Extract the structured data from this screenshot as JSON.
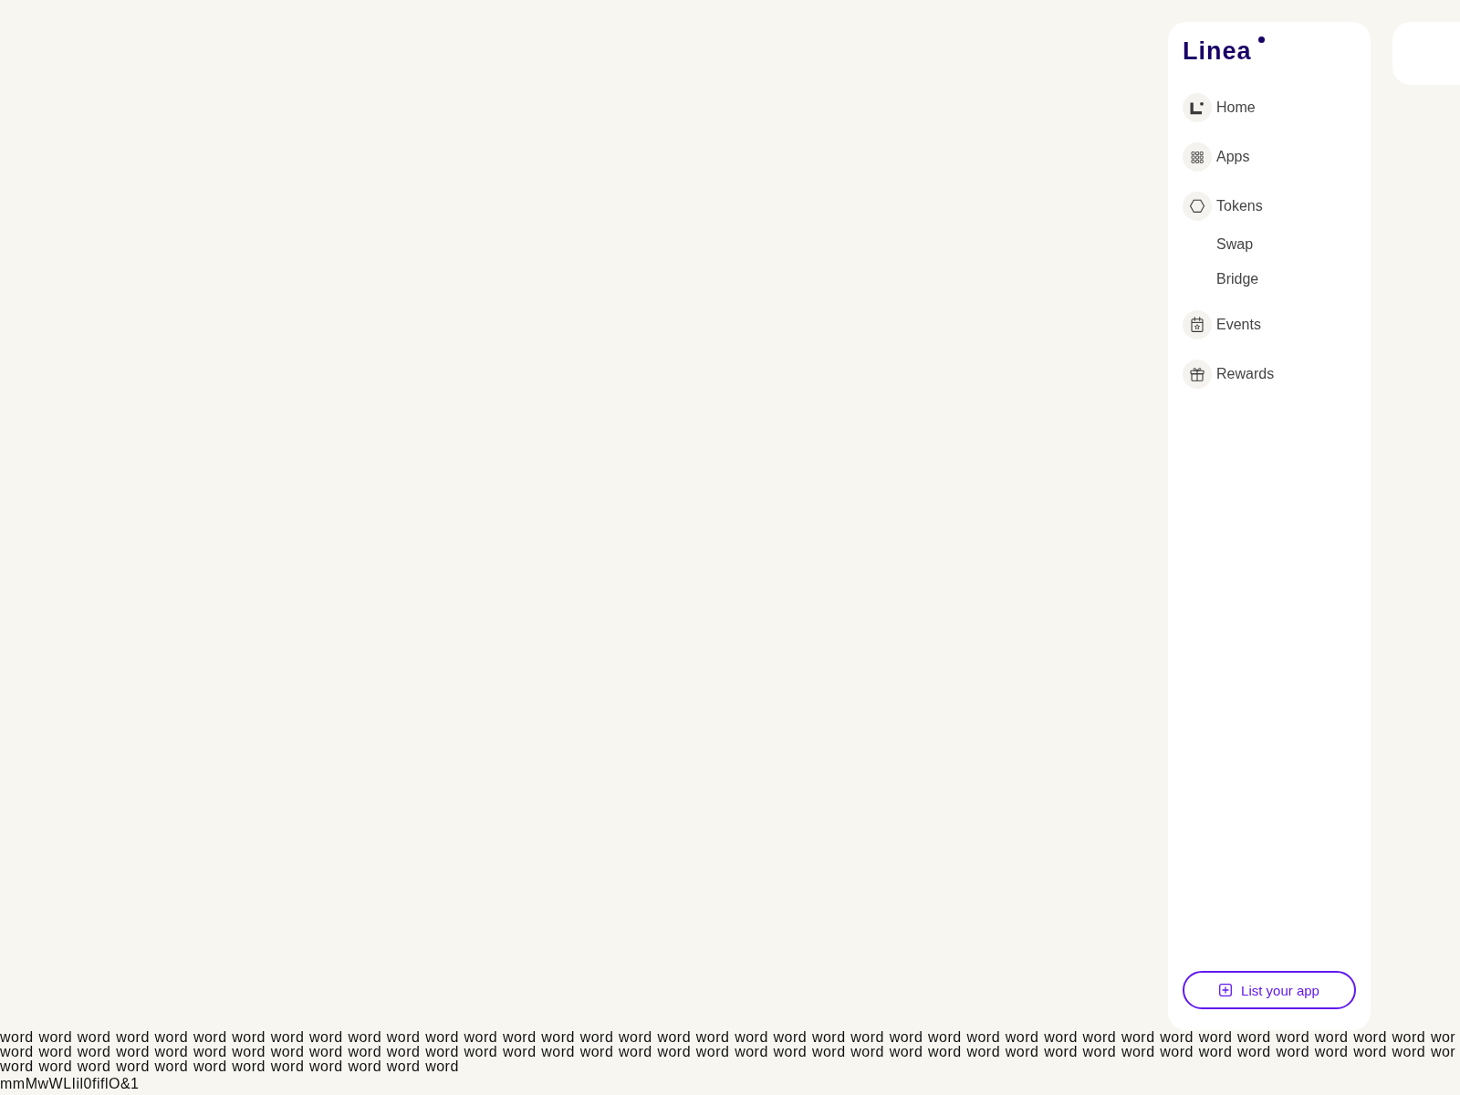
{
  "sidebar": {
    "logo": "Linea",
    "nav": [
      {
        "label": "Home"
      },
      {
        "label": "Apps"
      },
      {
        "label": "Tokens",
        "children": [
          {
            "label": "Swap"
          },
          {
            "label": "Bridge"
          }
        ]
      },
      {
        "label": "Events"
      },
      {
        "label": "Rewards"
      }
    ],
    "button": "List your app"
  },
  "text_lines": [
    "word word word word word word word word word word word word word word word word word word word word word word word word word word word word word word word word word word word word word wor",
    "word word word word word word word word word word word word word word word word word word word word word word word word word word word word word word word word word word word word word wor",
    "word word word word word word word word word word word word"
  ],
  "glyph_sample": "mmMwWLIil0fiflO&1"
}
